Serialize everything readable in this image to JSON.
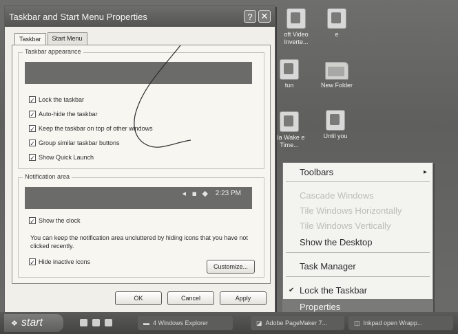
{
  "dialog": {
    "title": "Taskbar and Start Menu Properties",
    "help_glyph": "?",
    "close_glyph": "✕",
    "tabs": [
      {
        "label": "Taskbar",
        "active": true
      },
      {
        "label": "Start Menu",
        "active": false
      }
    ],
    "appearance": {
      "label": "Taskbar appearance",
      "options": [
        {
          "label": "Lock the taskbar",
          "checked": true
        },
        {
          "label": "Auto-hide the taskbar",
          "checked": true
        },
        {
          "label": "Keep the taskbar on top of other windows",
          "checked": true
        },
        {
          "label": "Group similar taskbar buttons",
          "checked": true
        },
        {
          "label": "Show Quick Launch",
          "checked": true
        }
      ]
    },
    "notification": {
      "label": "Notification area",
      "clock_preview": "2:23 PM",
      "show_clock": {
        "label": "Show the clock",
        "checked": true
      },
      "note": "You can keep the notification area uncluttered by hiding icons that you have not clicked recently.",
      "hide_inactive": {
        "label": "Hide inactive icons",
        "checked": true
      },
      "customize_label": "Customize..."
    },
    "buttons": {
      "ok": "OK",
      "cancel": "Cancel",
      "apply": "Apply"
    }
  },
  "desktop_icons": [
    {
      "label": "oft Video Inverte..."
    },
    {
      "label": "e"
    },
    {
      "label": "tun"
    },
    {
      "label": "New Folder"
    },
    {
      "label": "ala Wake e Time..."
    },
    {
      "label": "Until you"
    }
  ],
  "context_menu": {
    "items": [
      {
        "label": "Toolbars",
        "submenu": true,
        "enabled": true
      },
      {
        "label": "Cascade Windows",
        "enabled": false
      },
      {
        "label": "Tile Windows Horizontally",
        "enabled": false
      },
      {
        "label": "Tile Windows Vertically",
        "enabled": false
      },
      {
        "label": "Show the Desktop",
        "enabled": true
      },
      {
        "label": "Task Manager",
        "enabled": true
      },
      {
        "label": "Lock the Taskbar",
        "checked": true,
        "enabled": true
      },
      {
        "label": "Properties",
        "enabled": true,
        "highlighted": true
      }
    ],
    "submenu_arrow": "▸",
    "check_glyph": "✔"
  },
  "taskbar": {
    "start_label": "start",
    "tasks": [
      {
        "label": "4 Windows Explorer"
      },
      {
        "label": "Adobe PageMaker 7..."
      },
      {
        "label": "Inkpad open Wrapp..."
      }
    ]
  },
  "colors": {
    "highlight": "#7a7a78",
    "disabled_text": "#bcbcb8",
    "dialog_bg": "#f0efe9"
  }
}
